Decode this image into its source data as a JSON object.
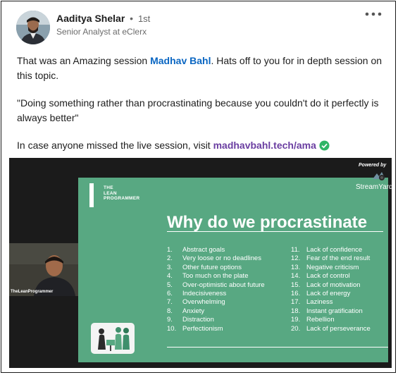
{
  "author": {
    "name": "Aaditya Shelar",
    "separator": "•",
    "degree": "1st",
    "headline": "Senior Analyst at eClerx"
  },
  "post": {
    "line1_before": "That was an Amazing session ",
    "line1_mention": "Madhav Bahl",
    "line1_after": ". Hats off to you for in depth session on",
    "line2": "this topic.",
    "quote_line1": "\"Doing something rather than procrastinating because you couldn't do it perfectly is",
    "quote_line2": "always better\"",
    "link_before": "In case anyone missed the live session, visit ",
    "link_text": "madhavbahl.tech/ama"
  },
  "video": {
    "powered_by": "Powered by",
    "brand": "StreamYard",
    "webcam_label": "TheLeanProgrammer",
    "slide": {
      "logo_line1": "THE",
      "logo_line2": "LEAN",
      "logo_line3": "PROGRAMMER",
      "title": "Why do we procrastinate",
      "reasons_left": [
        {
          "num": "1.",
          "text": "Abstract goals"
        },
        {
          "num": "2.",
          "text": "Very loose or no deadlines"
        },
        {
          "num": "3.",
          "text": "Other future options"
        },
        {
          "num": "4.",
          "text": "Too much on the plate"
        },
        {
          "num": "5.",
          "text": "Over-optimistic about future"
        },
        {
          "num": "6.",
          "text": "Indecisiveness"
        },
        {
          "num": "7.",
          "text": "Overwhelming"
        },
        {
          "num": "8.",
          "text": "Anxiety"
        },
        {
          "num": "9.",
          "text": "Distraction"
        },
        {
          "num": "10.",
          "text": "Perfectionism"
        }
      ],
      "reasons_right": [
        {
          "num": "11.",
          "text": "Lack of confidence"
        },
        {
          "num": "12.",
          "text": "Fear of the end result"
        },
        {
          "num": "13.",
          "text": "Negative criticism"
        },
        {
          "num": "14.",
          "text": "Lack of control"
        },
        {
          "num": "15.",
          "text": "Lack of motivation"
        },
        {
          "num": "16.",
          "text": "Lack of energy"
        },
        {
          "num": "17.",
          "text": "Laziness"
        },
        {
          "num": "18.",
          "text": "Instant gratification"
        },
        {
          "num": "19.",
          "text": "Rebellion"
        },
        {
          "num": "20.",
          "text": "Lack of perseverance"
        }
      ]
    }
  },
  "icons": {
    "more": "more-options-icon",
    "verified_link": "check-circle-icon"
  },
  "colors": {
    "mention": "#0a66c2",
    "link": "#6a3ea1",
    "slide_bg": "#58a882",
    "check": "#2fb566"
  }
}
